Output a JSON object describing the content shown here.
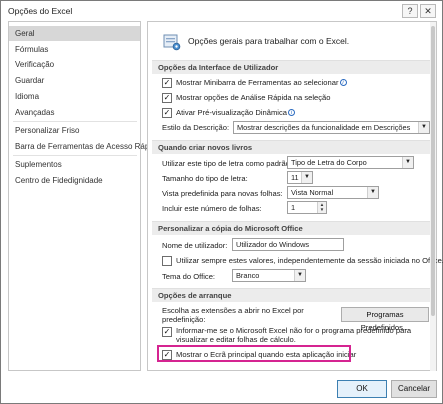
{
  "window": {
    "title": "Opções do Excel",
    "help_button": "?",
    "close_button": "✕"
  },
  "sidebar": {
    "items": [
      {
        "label": "Geral",
        "selected": true
      },
      {
        "label": "Fórmulas"
      },
      {
        "label": "Verificação"
      },
      {
        "label": "Guardar"
      },
      {
        "label": "Idioma"
      },
      {
        "label": "Avançadas"
      },
      {
        "label": "Personalizar Friso"
      },
      {
        "label": "Barra de Ferramentas de Acesso Rápido"
      },
      {
        "label": "Suplementos"
      },
      {
        "label": "Centro de Fidedignidade"
      }
    ]
  },
  "intro": {
    "text": "Opções gerais para trabalhar com o Excel.",
    "icon": "settings-icon"
  },
  "ui_options": {
    "header": "Opções da Interface de Utilizador",
    "mini_toolbar": {
      "label": "Mostrar Minibarra de Ferramentas ao selecionar",
      "checked": true
    },
    "quick_analysis": {
      "label": "Mostrar opções de Análise Rápida na seleção",
      "checked": true
    },
    "live_preview": {
      "label": "Ativar Pré-visualização Dinâmica",
      "checked": true
    },
    "screentip": {
      "label": "Estilo da Descrição:",
      "value": "Mostrar descrições da funcionalidade em Descrições"
    }
  },
  "new_workbooks": {
    "header": "Quando criar novos livros",
    "font": {
      "label": "Utilizar este tipo de letra como padrão:",
      "value": "Tipo de Letra do Corpo"
    },
    "font_size": {
      "label": "Tamanho do tipo de letra:",
      "value": "11"
    },
    "default_view": {
      "label": "Vista predefinida para novas folhas:",
      "value": "Vista Normal"
    },
    "sheets": {
      "label": "Incluir este número de folhas:",
      "value": "1"
    }
  },
  "personalize": {
    "header": "Personalizar a cópia do Microsoft Office",
    "username": {
      "label": "Nome de utilizador:",
      "value": "Utilizador do Windows"
    },
    "always_use": {
      "label": "Utilizar sempre estes valores, independentemente da sessão iniciada no Office.",
      "checked": false
    },
    "theme": {
      "label": "Tema do Office:",
      "value": "Branco"
    }
  },
  "startup": {
    "header": "Opções de arranque",
    "extensions_label_line1": "Escolha as extensões a abrir no Excel por",
    "extensions_label_line2": "predefinição:",
    "default_programs_button": "Programas Predefinidos...",
    "inform_line1": "Informar-me se o Microsoft Excel não for o programa predefinido para",
    "inform_line2": "visualizar e editar folhas de cálculo.",
    "inform_checked": true,
    "start_screen": {
      "label": "Mostrar o Ecrã principal quando esta aplicação iniciar",
      "checked": true
    }
  },
  "footer": {
    "ok": "OK",
    "cancel": "Cancelar"
  },
  "colors": {
    "accent_highlight": "#d52491",
    "selected_nav": "#d7d7d7"
  }
}
